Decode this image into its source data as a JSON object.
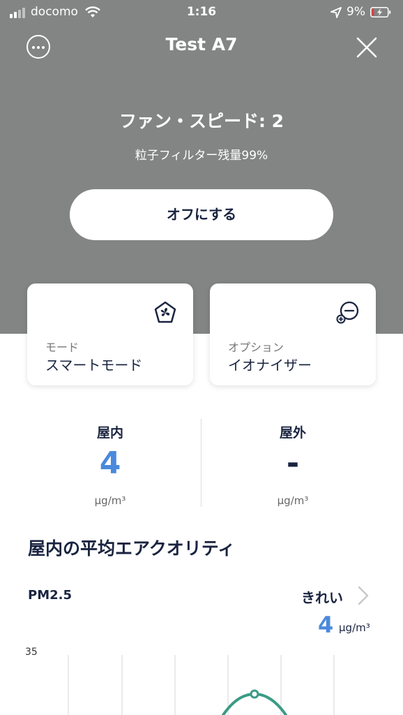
{
  "status_bar": {
    "carrier": "docomo",
    "time": "1:16",
    "battery": "9%"
  },
  "header": {
    "title": "Test A7",
    "menu_icon": "more-icon",
    "close_icon": "close-icon"
  },
  "device": {
    "fan_speed": "ファン・スピード: 2",
    "filter_status": "粒子フィルター残量99%",
    "off_button": "オフにする"
  },
  "cards": {
    "mode": {
      "label": "モード",
      "value": "スマートモード",
      "icon": "fan-icon"
    },
    "option": {
      "label": "オプション",
      "value": "イオナイザー",
      "icon": "ionizer-icon"
    }
  },
  "air_quality": {
    "indoor": {
      "title": "屋内",
      "value": "4",
      "unit": "μg/m³"
    },
    "outdoor": {
      "title": "屋外",
      "value": "-",
      "unit": "μg/m³"
    }
  },
  "average_section": {
    "title": "屋内の平均エアクオリティ",
    "pm_label": "PM2.5",
    "status": "きれい",
    "value": "4",
    "unit": "μg/m³"
  },
  "colors": {
    "header_bg": "#838584",
    "accent_blue": "#4a89dc",
    "navy": "#1a2440",
    "chart_line": "#3a9b86"
  },
  "chart_data": {
    "type": "line",
    "ytick_labels": [
      "35"
    ],
    "grid": true
  }
}
